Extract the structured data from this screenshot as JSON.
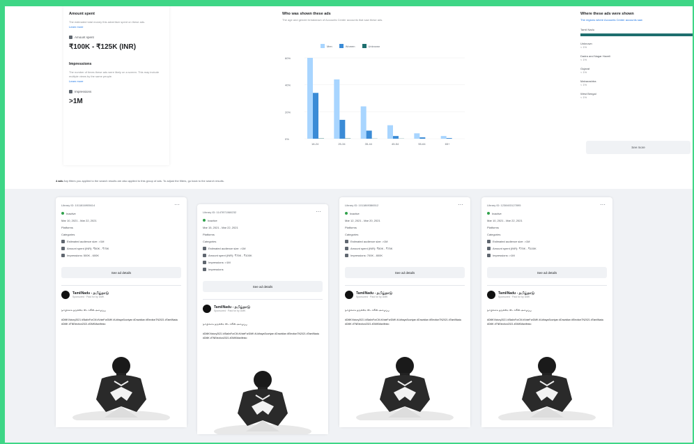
{
  "summary": {
    "amount_title": "Amount spent",
    "amount_desc": "The estimated total money this advertiser spent on these ads.",
    "learn_more": "Learn more",
    "amount_label": "Amount spent",
    "amount_value": "₹100K - ₹125K (INR)",
    "impressions_title": "Impressions",
    "impressions_desc": "The number of times these ads were likely on a screen. This may include multiple views by the same people.",
    "impressions_label": "Impressions",
    "impressions_value": ">1M"
  },
  "chart_data": {
    "type": "bar",
    "title": "Who was shown these ads",
    "subtitle": "The age and gender breakdown of Accounts Center accounts that saw these ads.",
    "categories": [
      "18-24",
      "25-34",
      "35-44",
      "45-54",
      "55-64",
      "65+"
    ],
    "series": [
      {
        "name": "Men",
        "values": [
          60,
          44,
          24,
          10,
          4,
          2
        ]
      },
      {
        "name": "Women",
        "values": [
          34,
          14,
          6,
          2,
          1,
          0.5
        ]
      },
      {
        "name": "Unknown",
        "values": [
          0.2,
          0.2,
          0.1,
          0.1,
          0,
          0
        ]
      }
    ],
    "yticks": [
      "0%",
      "20%",
      "40%",
      "60%"
    ],
    "ylim": [
      0,
      60
    ],
    "colors": {
      "Men": "#a8d5ff",
      "Women": "#3a8bd6",
      "Unknown": "#1d6e6e"
    }
  },
  "regions": {
    "title": "Where these ads were shown",
    "desc": "The regions where Accounts Center accounts saw",
    "items": [
      {
        "name": "Tamil Nadu",
        "pct": "",
        "fill": 1
      },
      {
        "name": "Unknown",
        "pct": "< 1%",
        "fill": 0
      },
      {
        "name": "Dadra and Nagar Haveli",
        "pct": "< 1%",
        "fill": 0
      },
      {
        "name": "Gujarat",
        "pct": "< 1%",
        "fill": 0
      },
      {
        "name": "Maharashtra",
        "pct": "< 1%",
        "fill": 0
      },
      {
        "name": "West Bengal",
        "pct": "< 1%",
        "fill": 0
      }
    ],
    "see_more": "See more"
  },
  "note": {
    "bold": "4 ads",
    "text": " Any filters you applied to the search results are also applied to this group of ads. To adjust the filters, go back to the search results."
  },
  "cards": [
    {
      "id": "Library ID: 1011816905614",
      "status": "Inactive",
      "dates": "Mar 10, 2021 - Mar 22, 2021",
      "platforms": "Platforms",
      "categories": "Categories",
      "est": "Estimated audience size: >1M",
      "spent": "Amount spent (INR): ₹50K - ₹75K",
      "impr": "Impressions: 500K - 600K",
      "btn": "See ad details",
      "page": "TamilNadu - தமிழ்நாடு",
      "sponsored": "Sponsored · Paid for by DMK",
      "text1": "நம்பிக்கை தருகின்ற ஸ்டாலின் அழைப்பு",
      "text2": "#DMKVictory2021 #StalinForCM #VoteForDMK #UdhayaSooriyan #Dravidian #ElectionTN2021 #TamilNadu #DMK #TNElection2021 #DMKManifesto"
    },
    {
      "id": "Library ID: 1147871068232",
      "status": "Inactive",
      "dates": "Mar 15, 2021 - Mar 22, 2021",
      "platforms": "Platforms",
      "categories": "Categories",
      "est": "Estimated audience size: >1M",
      "spent": "Amount spent (INR): ₹75K - ₹100K",
      "impr": "Impressions: >1M",
      "extra": "Impressions",
      "btn": "See ad details",
      "page": "TamilNadu - தமிழ்நாடு",
      "sponsored": "Sponsored · Paid for by DMK",
      "text1": "நம்பிக்கை தருகின்ற ஸ்டாலின் அழைப்பு",
      "text2": "#DMKVictory2021 #StalinForCM #VoteForDMK #UdhayaSooriyan #Dravidian #ElectionTN2021 #TamilNadu #DMK #TNElection2021 #DMKManifesto"
    },
    {
      "id": "Library ID: 1011869386512",
      "status": "Inactive",
      "dates": "Mar 12, 2021 - Mar 20, 2021",
      "platforms": "Platforms",
      "categories": "Categories",
      "est": "Estimated audience size: >1M",
      "spent": "Amount spent (INR): ₹50K - ₹75K",
      "impr": "Impressions: 700K - 800K",
      "btn": "See ad details",
      "page": "TamilNadu - தமிழ்நாடு",
      "sponsored": "Sponsored · Paid for by DMK",
      "text1": "நம்பிக்கை தருகின்ற ஸ்டாலின் அழைப்பு",
      "text2": "#DMKVictory2021 #StalinForCM #VoteForDMK #UdhayaSooriyan #Dravidian #ElectionTN2021 #TamilNadu #DMK #TNElection2021 #DMKManifesto"
    },
    {
      "id": "Library ID: 1238403127895",
      "status": "Inactive",
      "dates": "Mar 10, 2021 - Mar 22, 2021",
      "platforms": "Platforms",
      "categories": "Categories",
      "est": "Estimated audience size: >1M",
      "spent": "Amount spent (INR): ₹75K - ₹100K",
      "impr": "Impressions: >1M",
      "btn": "See ad details",
      "page": "TamilNadu - தமிழ்நாடு",
      "sponsored": "Sponsored · Paid for by DMK",
      "text1": "நம்பிக்கை தருகின்ற ஸ்டாலின் அழைப்பு",
      "text2": "#DMKVictory2021 #StalinForCM #VoteForDMK #UdhayaSooriyan #Dravidian #ElectionTN2021 #TamilNadu #DMK #TNElection2021 #DMKManifesto"
    }
  ]
}
